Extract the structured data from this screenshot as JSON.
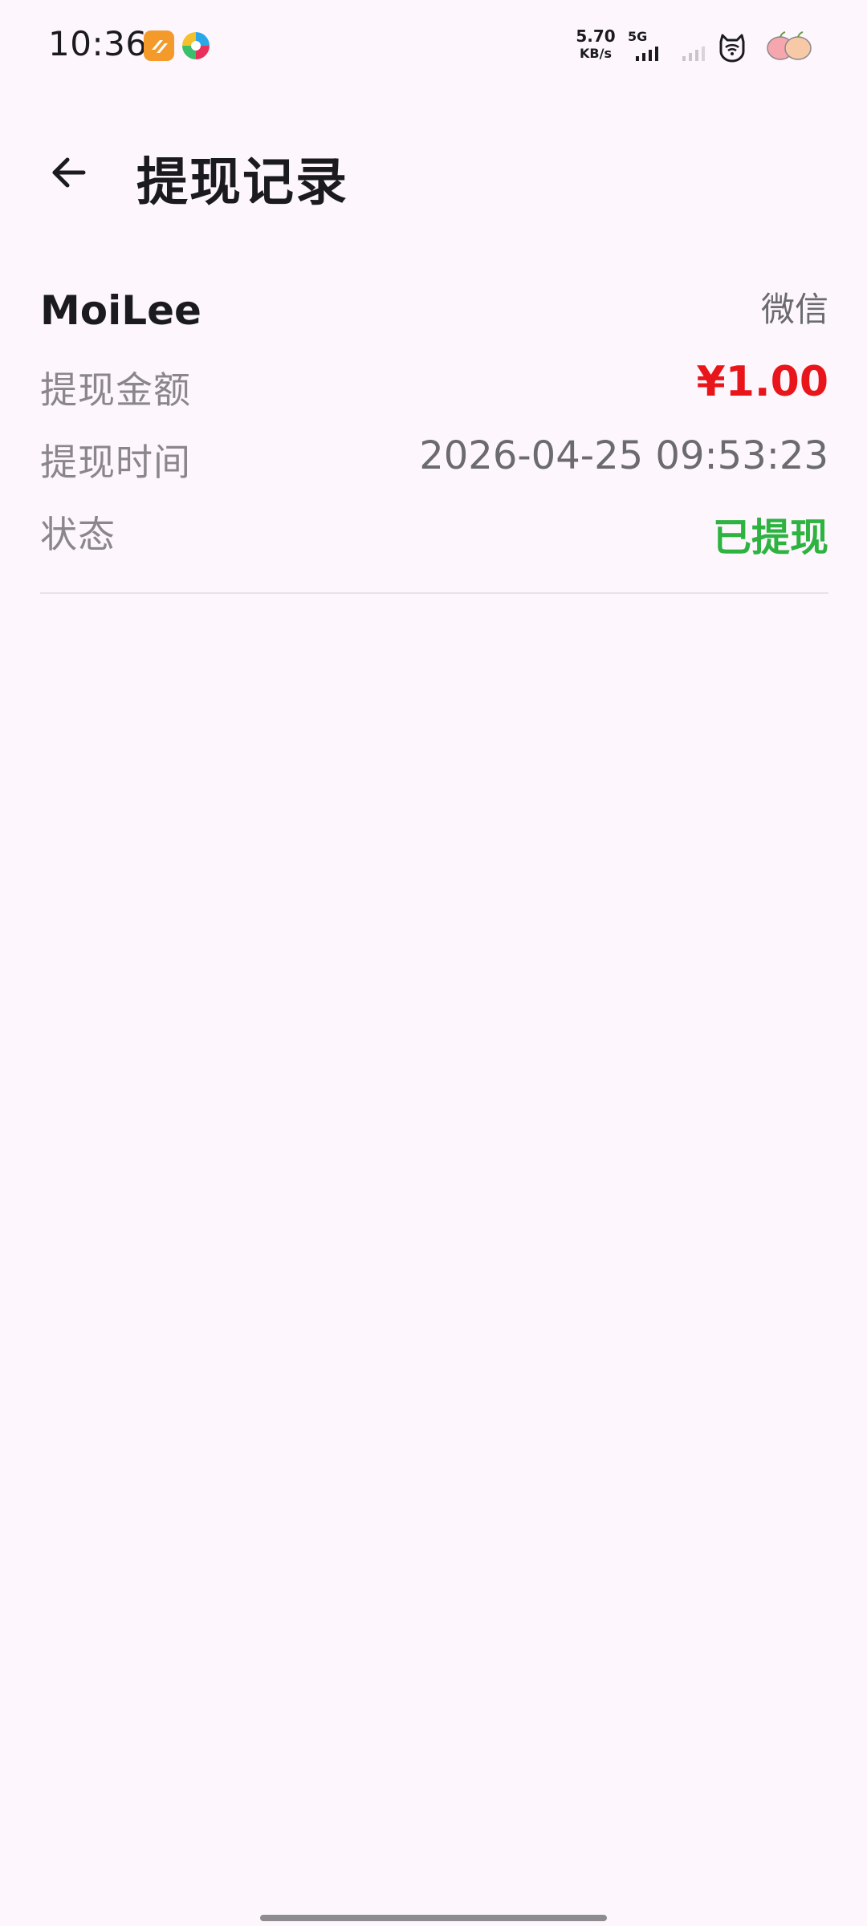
{
  "status_bar": {
    "time": "10:36",
    "net_speed_value": "5.70",
    "net_speed_unit": "KB/s",
    "network_type": "5G",
    "icons": [
      "notification-app-orange-icon",
      "notification-app-multicolor-icon",
      "signal-icon",
      "signal-weak-icon",
      "wifi-icon",
      "battery-icon"
    ]
  },
  "app_bar": {
    "back_icon": "arrow-left-icon",
    "title": "提现记录"
  },
  "record": {
    "account_name": "MoiLee",
    "channel": "微信",
    "rows": [
      {
        "label": "提现金额",
        "value": "¥1.00"
      },
      {
        "label": "提现时间",
        "value": "2026-04-25 09:53:23"
      },
      {
        "label": "状态",
        "value": "已提现"
      }
    ]
  },
  "colors": {
    "background": "#fdf6fd",
    "amount": "#e8151a",
    "status_success": "#2db33f",
    "label": "#8a878c",
    "value": "#6b6b6e",
    "title": "#1b1b1f"
  }
}
